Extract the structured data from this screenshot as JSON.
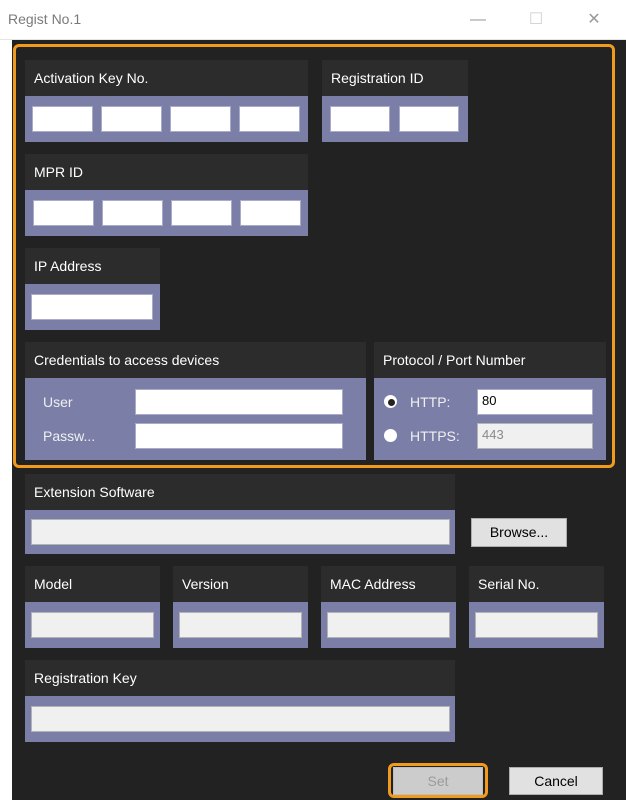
{
  "window": {
    "title": "Regist No.1",
    "minimize": "—",
    "maximize": "☐",
    "close": "✕"
  },
  "activation": {
    "header": "Activation Key No.",
    "fields": [
      "",
      "",
      "",
      ""
    ]
  },
  "registration_id": {
    "header": "Registration ID",
    "fields": [
      "",
      ""
    ]
  },
  "mpr_id": {
    "header": "MPR ID",
    "fields": [
      "",
      "",
      "",
      ""
    ]
  },
  "ip_address": {
    "header": "IP Address",
    "value": ""
  },
  "credentials": {
    "header": "Credentials to access devices",
    "user_label": "User",
    "user_value": "",
    "password_label": "Passw...",
    "password_value": ""
  },
  "protocol": {
    "header": "Protocol / Port Number",
    "http_label": "HTTP:",
    "http_port": "80",
    "https_label": "HTTPS:",
    "https_port": "443",
    "selected": "HTTP"
  },
  "extension": {
    "header": "Extension Software",
    "value": "",
    "browse_label": "Browse..."
  },
  "model": {
    "header": "Model",
    "value": ""
  },
  "version": {
    "header": "Version",
    "value": ""
  },
  "mac": {
    "header": "MAC Address",
    "value": ""
  },
  "serial": {
    "header": "Serial No.",
    "value": ""
  },
  "registration_key": {
    "header": "Registration Key",
    "value": ""
  },
  "footer": {
    "set_label": "Set",
    "cancel_label": "Cancel"
  },
  "colors": {
    "highlight": "#f29a1c",
    "panel": "#7b7fa8",
    "header": "#2c2c2c",
    "background": "#222222"
  }
}
